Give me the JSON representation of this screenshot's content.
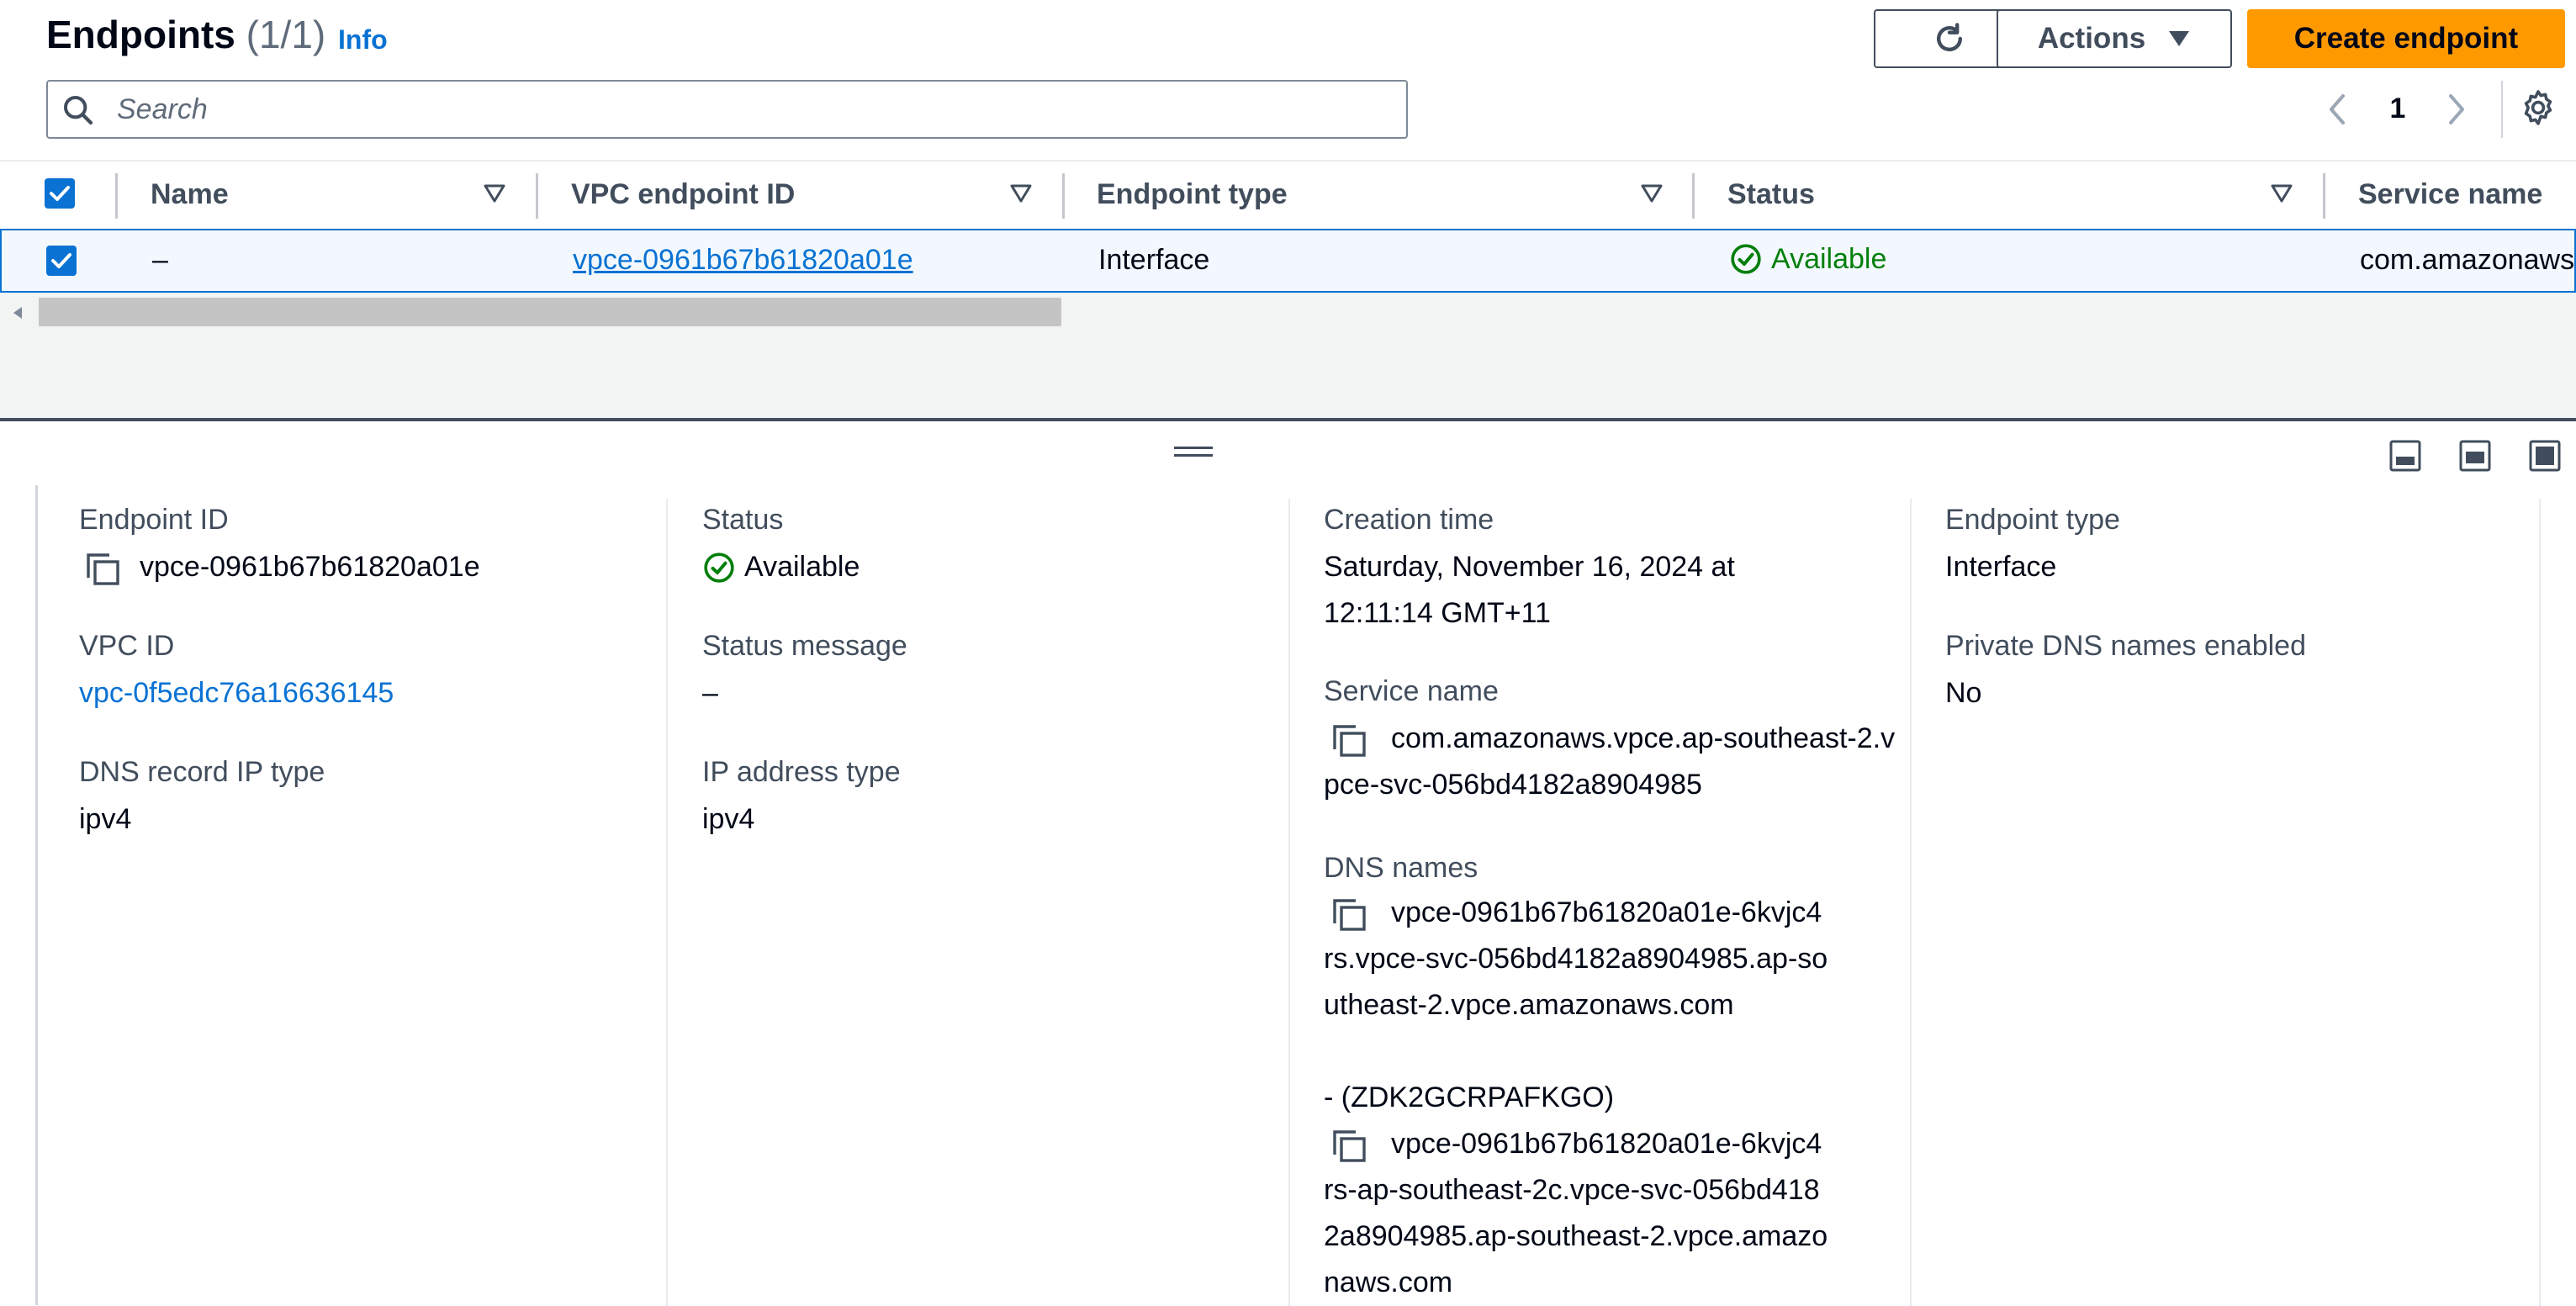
{
  "header": {
    "title": "Endpoints",
    "count": "(1/1)",
    "info_link": "Info",
    "actions_label": "Actions",
    "create_label": "Create endpoint"
  },
  "search": {
    "placeholder": "Search"
  },
  "pagination": {
    "current_page": "1"
  },
  "table": {
    "columns": [
      "Name",
      "VPC endpoint ID",
      "Endpoint type",
      "Status",
      "Service name"
    ],
    "rows": [
      {
        "name": "–",
        "vpc_endpoint_id": "vpce-0961b67b61820a01e",
        "endpoint_type": "Interface",
        "status": "Available",
        "service_name": "com.amazonaws"
      }
    ]
  },
  "details": {
    "endpoint_id_label": "Endpoint ID",
    "endpoint_id_value": "vpce-0961b67b61820a01e",
    "vpc_id_label": "VPC ID",
    "vpc_id_value": "vpc-0f5edc76a16636145",
    "dns_record_ip_type_label": "DNS record IP type",
    "dns_record_ip_type_value": "ipv4",
    "status_label": "Status",
    "status_value": "Available",
    "status_message_label": "Status message",
    "status_message_value": "–",
    "ip_address_type_label": "IP address type",
    "ip_address_type_value": "ipv4",
    "creation_time_label": "Creation time",
    "creation_time_value": "Saturday, November 16, 2024 at 12:11:14 GMT+11",
    "service_name_label": "Service name",
    "service_name_value": "com.amazonaws.vpce.ap-southeast-2.vpce-svc-056bd4182a8904985",
    "dns_names_label": "DNS names",
    "dns_name_1": "vpce-0961b67b61820a01e-6kvjc4rs.vpce-svc-056bd4182a8904985.ap-southeast-2.vpce.amazonaws.com",
    "dns_name_1_zone": "- (ZDK2GCRPAFKGO)",
    "dns_name_2": "vpce-0961b67b61820a01e-6kvjc4rs-ap-southeast-2c.vpce-svc-056bd4182a8904985.ap-southeast-2.vpce.amazonaws.com",
    "endpoint_type_label": "Endpoint type",
    "endpoint_type_value": "Interface",
    "private_dns_label": "Private DNS names enabled",
    "private_dns_value": "No"
  },
  "icons": {
    "refresh": "refresh-icon",
    "actions_caret": "caret-down-icon",
    "search": "search-icon",
    "prev": "chevron-left-icon",
    "next": "chevron-right-icon",
    "settings": "gear-icon",
    "sort": "sort-caret-icon",
    "status": "check-circle-icon",
    "copy": "copy-icon",
    "drag": "drag-handle-icon"
  },
  "colors": {
    "primary": "#ff9900",
    "link": "#0972d3",
    "success": "#037f0c",
    "selected_row_bg": "#f2f8fd"
  }
}
